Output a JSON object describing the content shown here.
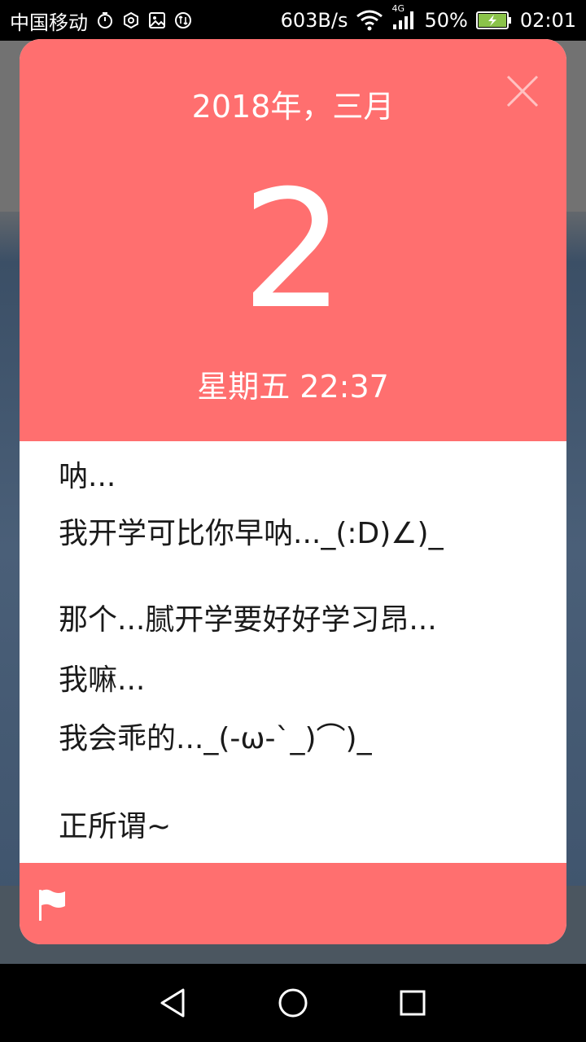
{
  "status_bar": {
    "carrier": "中国移动",
    "speed": "603B/s",
    "network": "4G",
    "battery": "50%",
    "time": "02:01"
  },
  "calendar": {
    "year_month": "2018年，三月",
    "day": "2",
    "weekday_time": "星期五 22:37"
  },
  "message": {
    "lines": [
      "呐...",
      "我开学可比你早呐..._(:D)∠)_",
      "那个...腻开学要好好学习昂...",
      "我嘛...",
      "我会乖的..._(-ω-`_)⌒)_",
      "正所谓~"
    ]
  },
  "icons": {
    "close": "close-icon",
    "flag": "flag-icon",
    "back": "back-icon",
    "home": "home-icon",
    "recents": "recents-icon"
  },
  "colors": {
    "accent": "#ff6f6f",
    "body_bg": "#ffffff",
    "text": "#1a1a1a"
  }
}
